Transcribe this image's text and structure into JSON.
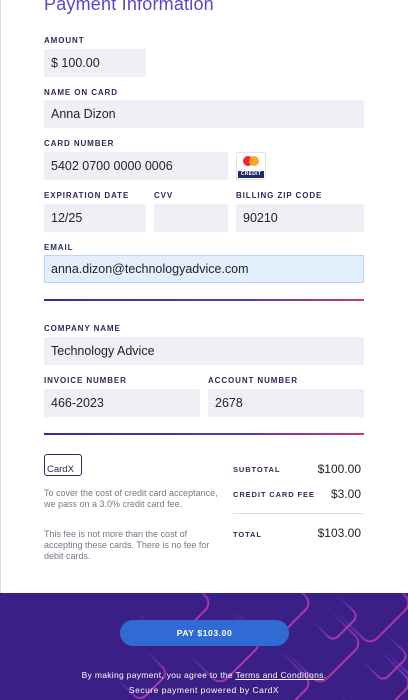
{
  "header": {
    "title": "Payment Information"
  },
  "payment": {
    "amount_label": "AMOUNT",
    "amount_value": "$ 100.00",
    "name_label": "NAME ON CARD",
    "name_value": "Anna Dizon",
    "card_number_label": "CARD NUMBER",
    "card_number_value": "5402 0700 0000 0006",
    "card_brand": {
      "icon": "mastercard-icon",
      "tag": "CREDIT"
    },
    "expiration_label": "EXPIRATION DATE",
    "expiration_value": "12/25",
    "cvv_label": "CVV",
    "cvv_value": "",
    "zip_label": "BILLING ZIP CODE",
    "zip_value": "90210",
    "email_label": "EMAIL",
    "email_value": "anna.dizon@technologyadvice.com"
  },
  "invoice": {
    "company_label": "COMPANY NAME",
    "company_value": "Technology Advice",
    "invoice_label": "INVOICE NUMBER",
    "invoice_value": "466-2023",
    "account_label": "ACCOUNT NUMBER",
    "account_value": "2678"
  },
  "summary": {
    "logo_text": "CardX",
    "note_1": "To cover the cost of credit card acceptance, we pass on a 3.0% credit card fee.",
    "note_2": "This fee is not more than the cost of accepting these cards. There is no fee for debit cards.",
    "subtotal_label": "SUBTOTAL",
    "subtotal_value": "$100.00",
    "fee_label": "CREDIT CARD FEE",
    "fee_value": "$3.00",
    "total_label": "TOTAL",
    "total_value": "$103.00"
  },
  "footer": {
    "pay_button": "PAY $103.00",
    "agree_prefix": "By making payment, you agree to the ",
    "terms_link": "Terms and Conditions",
    "agree_suffix": ".",
    "secure_text": "Secure payment powered by CardX"
  },
  "colors": {
    "accent": "#5a46c8",
    "label": "#2d2a5c",
    "field_bg": "#eef0f5",
    "footer_bg": "#3a1f86",
    "pay_button": "#2f6bd2",
    "divider_end": "#d0386b"
  }
}
